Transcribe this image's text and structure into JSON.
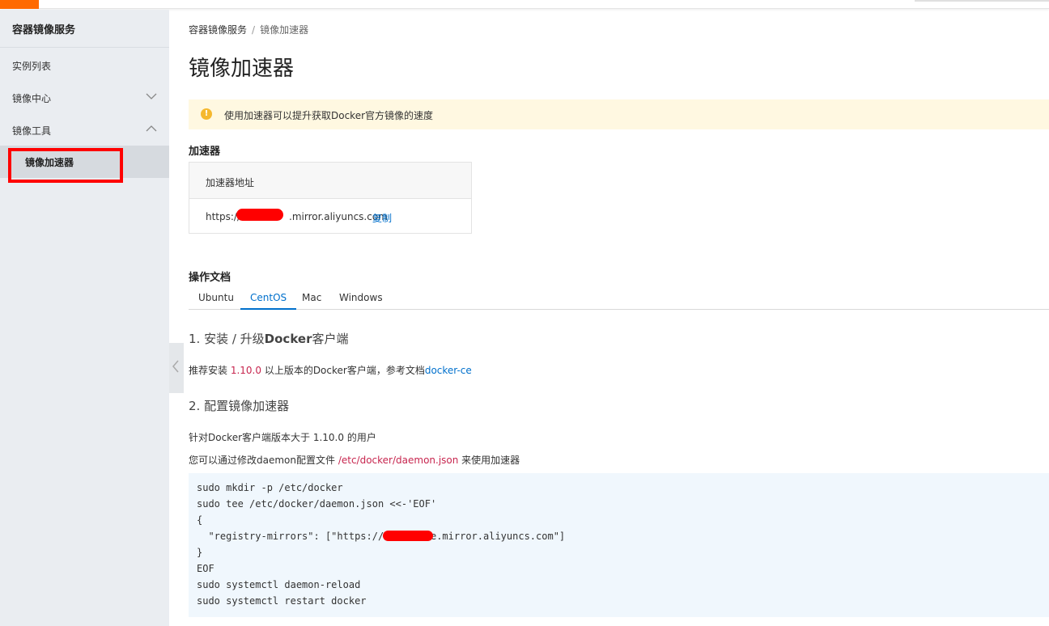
{
  "sidebar": {
    "title": "容器镜像服务",
    "items": [
      {
        "label": "实例列表",
        "chevron": ""
      },
      {
        "label": "镜像中心",
        "chevron": "chevron-down-icon"
      },
      {
        "label": "镜像工具",
        "chevron": "chevron-up-icon"
      },
      {
        "label": "镜像加速器",
        "chevron": ""
      }
    ]
  },
  "breadcrumb": {
    "root": "容器镜像服务",
    "sep": "/",
    "current": "镜像加速器"
  },
  "page": {
    "title": "镜像加速器"
  },
  "notice": {
    "text": "使用加速器可以提升获取Docker官方镜像的速度",
    "icon": "warning-icon"
  },
  "accelerator": {
    "heading": "加速器",
    "column": "加速器地址",
    "url_prefix": "https://",
    "url_suffix": ".mirror.aliyuncs.com",
    "copy": "复制"
  },
  "docs": {
    "heading": "操作文档",
    "tabs": [
      "Ubuntu",
      "CentOS",
      "Mac",
      "Windows"
    ],
    "active_tab": "CentOS",
    "step1": {
      "num": "1. 安装 / 升级",
      "bold": "Docker",
      "rest": "客户端"
    },
    "step1_text": {
      "a": "推荐安装 ",
      "ver": "1.10.0",
      "b": " 以上版本的Docker客户端，参考文档",
      "link": "docker-ce"
    },
    "step2": {
      "title": "2. 配置镜像加速器"
    },
    "step2_text1": "针对Docker客户端版本大于 1.10.0 的用户",
    "step2_text2": {
      "a": "您可以通过修改daemon配置文件 ",
      "path": "/etc/docker/daemon.json",
      "b": " 来使用加速器"
    },
    "code": [
      "sudo mkdir -p /etc/docker",
      "sudo tee /etc/docker/daemon.json <<-'EOF'",
      "{",
      "  \"registry-mirrors\": [\"https://xxxxxxxxe.mirror.aliyuncs.com\"]",
      "}",
      "EOF",
      "sudo systemctl daemon-reload",
      "sudo systemctl restart docker"
    ]
  }
}
